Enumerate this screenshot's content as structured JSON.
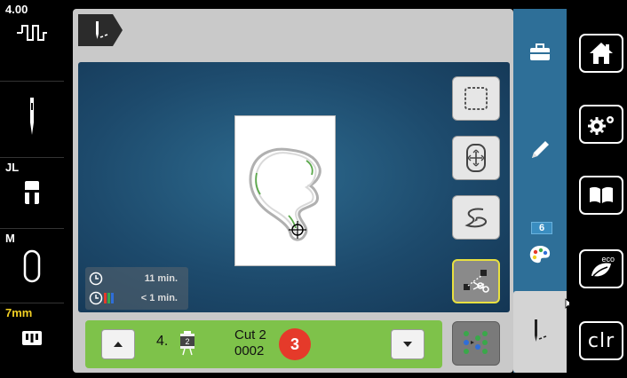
{
  "left_sidebar": {
    "stitch_width": "4.00",
    "foot_label": "JL",
    "hoop_label": "M",
    "needle_size": "7mm"
  },
  "design_info": {
    "time_total": "11 min.",
    "time_color": "< 1 min."
  },
  "color_bar": {
    "color_number": "4.",
    "color_index_icon": "2",
    "cut_line1": "Cut 2",
    "cut_line2": "0002",
    "cut_badge": "3"
  },
  "tabs": {
    "color_count": "6"
  },
  "right_sidebar": {
    "eco_label": "eco",
    "clr_label": "clr"
  },
  "icons": [
    "stitch-width-icon",
    "needle-icon",
    "presser-foot-icon",
    "hoop-icon",
    "stitch-plate-icon",
    "embroidery-mode-icon",
    "hoop-frame-icon",
    "move-hoop-icon",
    "connect-stitch-icon",
    "cut-connecting-thread-icon",
    "color-sequence-icon",
    "case-icon",
    "edit-pencil-icon",
    "color-palette-icon",
    "stitch-tab-icon",
    "home-icon",
    "settings-icon",
    "tutorial-book-icon",
    "eco-leaf-icon"
  ],
  "colors": {
    "accent_green": "#7ec24a",
    "cut_badge_red": "#e53a2a",
    "canvas_blue": "#1d4a6c",
    "tab_blue": "#2e6f98",
    "active_outline_yellow": "#e8e040"
  }
}
